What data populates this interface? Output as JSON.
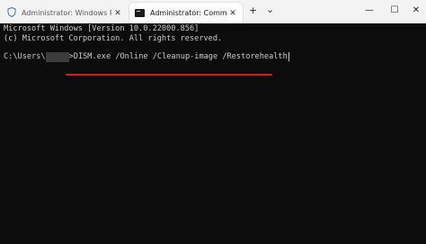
{
  "tabs": [
    {
      "label": "Administrator: Windows Powe",
      "icon": "powershell-shield-icon",
      "active": false
    },
    {
      "label": "Administrator: Command Pro",
      "icon": "command-prompt-icon",
      "active": true
    }
  ],
  "tab_controls": {
    "new_tab": "+",
    "dropdown": "⌄"
  },
  "window_controls": {
    "minimize": "—",
    "maximize": "☐",
    "close": "✕"
  },
  "terminal": {
    "line1": "Microsoft Windows [Version 10.0.22000.856]",
    "line2": "(c) Microsoft Corporation. All rights reserved.",
    "prompt_prefix": "C:\\Users\\",
    "prompt_suffix": ">",
    "command": "DISM.exe /Online /Cleanup-image /Restorehealth"
  },
  "colors": {
    "background": "#0c0c0c",
    "text": "#cccccc",
    "highlight_underline": "#d81b1b",
    "titlebar": "#f3f3f3"
  }
}
